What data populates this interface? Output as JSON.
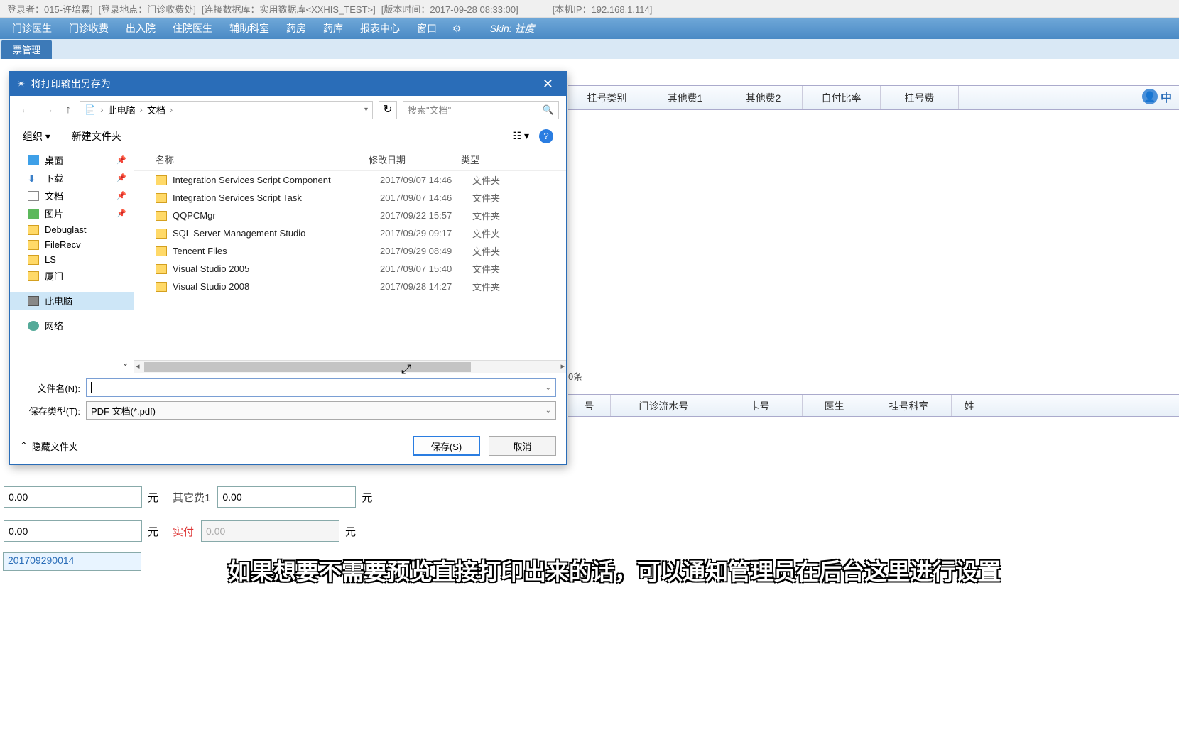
{
  "titlebar": {
    "login_user": "登录者：015-许培霖]",
    "login_loc": "[登录地点：门诊收费处]",
    "db": "[连接数据库：实用数据库<XXHIS_TEST>]",
    "ver": "[版本时间：2017-09-28 08:33:00]",
    "ip": "[本机IP：192.168.1.114]"
  },
  "menu": {
    "items": [
      "门诊医生",
      "门诊收费",
      "出入院",
      "住院医生",
      "辅助科室",
      "药房",
      "药库",
      "报表中心",
      "窗口"
    ],
    "skin": "Skin: 社度"
  },
  "subtab": "票管理",
  "bg": {
    "headers": [
      "挂号类别",
      "其他费1",
      "其他费2",
      "自付比率",
      "挂号费"
    ],
    "user_short": "中",
    "status": "0条",
    "headers2": [
      "号",
      "门诊流水号",
      "卡号",
      "医生",
      "挂号科室",
      "姓"
    ]
  },
  "bottom": {
    "f1_val": "0.00",
    "unit": "元",
    "other_lab": "其它费1",
    "other_val": "0.00",
    "f3_val": "0.00",
    "pay_lab": "实付",
    "pay_val": "0.00",
    "receipt": "201709290014"
  },
  "subtitle": "如果想要不需要预览直接打印出来的话，可以通知管理员在后台这里进行设置",
  "dialog": {
    "title": "将打印输出另存为",
    "crumb1": "此电脑",
    "crumb2": "文档",
    "search_ph": "搜索\"文档\"",
    "organize": "组织",
    "newfolder": "新建文件夹",
    "side": {
      "desktop": "桌面",
      "downloads": "下载",
      "documents": "文档",
      "pictures": "图片",
      "debuglast": "Debuglast",
      "filerecv": "FileRecv",
      "ls": "LS",
      "xiamen": "厦门",
      "thispc": "此电脑",
      "network": "网络"
    },
    "cols": {
      "name": "名称",
      "date": "修改日期",
      "type": "类型"
    },
    "files": [
      {
        "n": "Integration Services Script Component",
        "d": "2017/09/07 14:46",
        "t": "文件夹"
      },
      {
        "n": "Integration Services Script Task",
        "d": "2017/09/07 14:46",
        "t": "文件夹"
      },
      {
        "n": "QQPCMgr",
        "d": "2017/09/22 15:57",
        "t": "文件夹"
      },
      {
        "n": "SQL Server Management Studio",
        "d": "2017/09/29 09:17",
        "t": "文件夹"
      },
      {
        "n": "Tencent Files",
        "d": "2017/09/29 08:49",
        "t": "文件夹"
      },
      {
        "n": "Visual Studio 2005",
        "d": "2017/09/07 15:40",
        "t": "文件夹"
      },
      {
        "n": "Visual Studio 2008",
        "d": "2017/09/28 14:27",
        "t": "文件夹"
      }
    ],
    "fname_lab": "文件名(N):",
    "ftype_lab": "保存类型(T):",
    "ftype_val": "PDF 文档(*.pdf)",
    "hide": "隐藏文件夹",
    "save": "保存(S)",
    "cancel": "取消"
  }
}
